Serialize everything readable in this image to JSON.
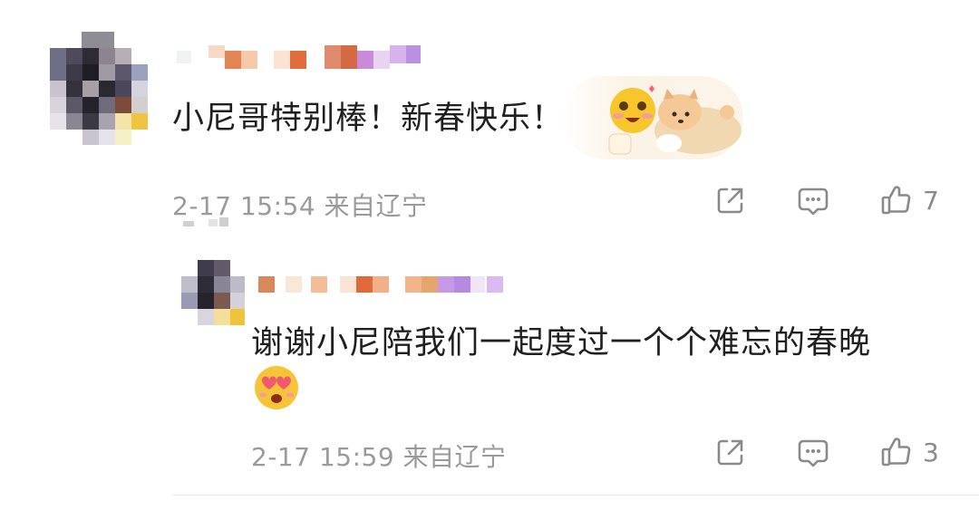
{
  "comments": [
    {
      "text": "小尼哥特别棒！新春快乐！",
      "meta": "2-17 15:54 来自辽宁",
      "likes": "7",
      "sticker": "smiley-with-shiba-dog-sticker"
    },
    {
      "text_line1": "谢谢小尼陪我们一起度过一个个难忘的春晚",
      "meta": "2-17 15:59 来自辽宁",
      "likes": "3",
      "emoji": "heart-eyes-emoji"
    }
  ],
  "icons": {
    "share": "share-icon",
    "comment": "comment-icon",
    "like": "thumbs-up-icon"
  },
  "colors": {
    "text": "#1f1f1f",
    "meta": "#9a9a9a",
    "icon": "#8a8a8a"
  }
}
